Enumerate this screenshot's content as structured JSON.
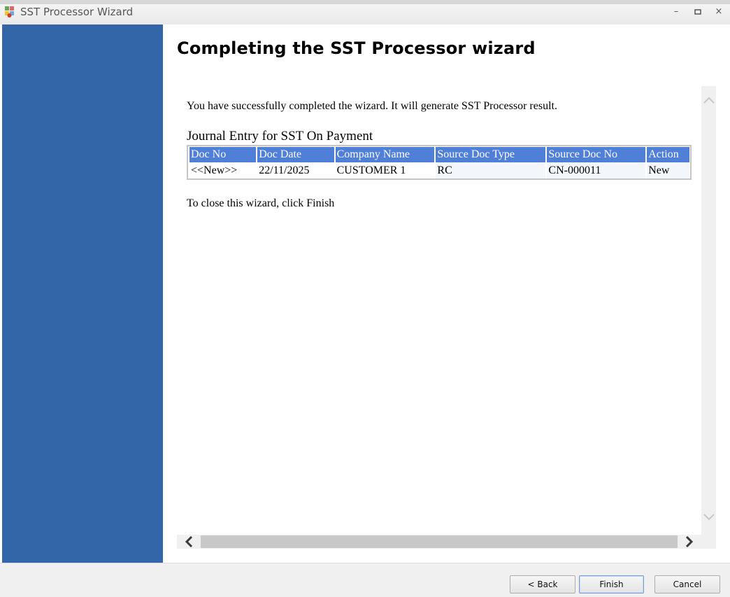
{
  "window": {
    "title": "SST Processor Wizard",
    "controls": {
      "minimize": "–",
      "maximize": "▫",
      "close": "×"
    }
  },
  "page": {
    "heading": "Completing the SST Processor wizard",
    "intro": "You have successfully completed the wizard. It will generate SST Processor result.",
    "caption": "Journal Entry for SST On Payment",
    "closing": "To close this wizard, click Finish"
  },
  "table": {
    "headers": [
      "Doc No",
      "Doc Date",
      "Company Name",
      "Source Doc Type",
      "Source Doc No",
      "Action"
    ],
    "rows": [
      [
        "<<New>>",
        "22/11/2025",
        "CUSTOMER 1",
        "RC",
        "CN-000011",
        "New"
      ]
    ]
  },
  "scrollbars": {
    "up": "︿",
    "down": "﹀",
    "left": "❮",
    "right": "❯"
  },
  "buttons": {
    "back": "< Back",
    "finish": "Finish",
    "cancel": "Cancel"
  },
  "colors": {
    "sidebar": "#3366a8",
    "header_row": "#4f7fd6"
  }
}
